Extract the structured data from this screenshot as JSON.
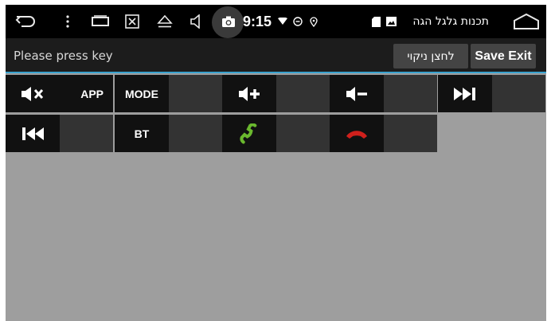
{
  "statusbar": {
    "time": "9:15",
    "notification_title": "תכנות גלגל הגה",
    "icons": [
      "back-arrow-icon",
      "more-vert-icon",
      "recents-icon",
      "screenshot-box-icon",
      "eject-icon",
      "volume-icon",
      "camera-icon",
      "wifi-icon",
      "dnd-icon",
      "location-icon",
      "sd-card-icon",
      "image-icon",
      "home-icon"
    ]
  },
  "header": {
    "prompt": "Please press key",
    "clear_label": "לחצן ניקוי",
    "save_exit_label": "Save Exit",
    "accent_color": "#39a3cf"
  },
  "keys": [
    {
      "label": "",
      "icon": "mute-icon"
    },
    {
      "label": "APP",
      "icon": ""
    },
    {
      "label": "MODE",
      "icon": ""
    },
    {
      "label": "",
      "icon": "volume-up-icon"
    },
    {
      "label": "",
      "icon": "volume-down-icon"
    },
    {
      "label": "",
      "icon": "next-track-icon"
    },
    {
      "label": "",
      "icon": "previous-track-icon"
    },
    {
      "label": "BT",
      "icon": ""
    },
    {
      "label": "",
      "icon": "call-answer-icon"
    },
    {
      "label": "",
      "icon": "call-end-icon"
    }
  ]
}
